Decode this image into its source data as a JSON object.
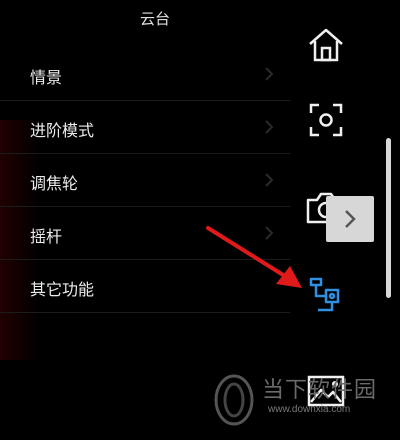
{
  "panel": {
    "title": "云台"
  },
  "menu": {
    "items": [
      {
        "label": "情景"
      },
      {
        "label": "进阶模式"
      },
      {
        "label": "调焦轮"
      },
      {
        "label": "摇杆"
      },
      {
        "label": "其它功能"
      }
    ]
  },
  "rail": {
    "icons": [
      "home-icon",
      "focus-frame-icon",
      "camera-icon",
      "gimbal-icon",
      "gallery-icon"
    ],
    "active_icon": "gimbal-icon",
    "active_color": "#2f8fe0"
  },
  "annotation": {
    "arrow_color": "#e01a1a"
  },
  "watermark": {
    "title": "当下软件园",
    "url": "www.downxia.com"
  }
}
